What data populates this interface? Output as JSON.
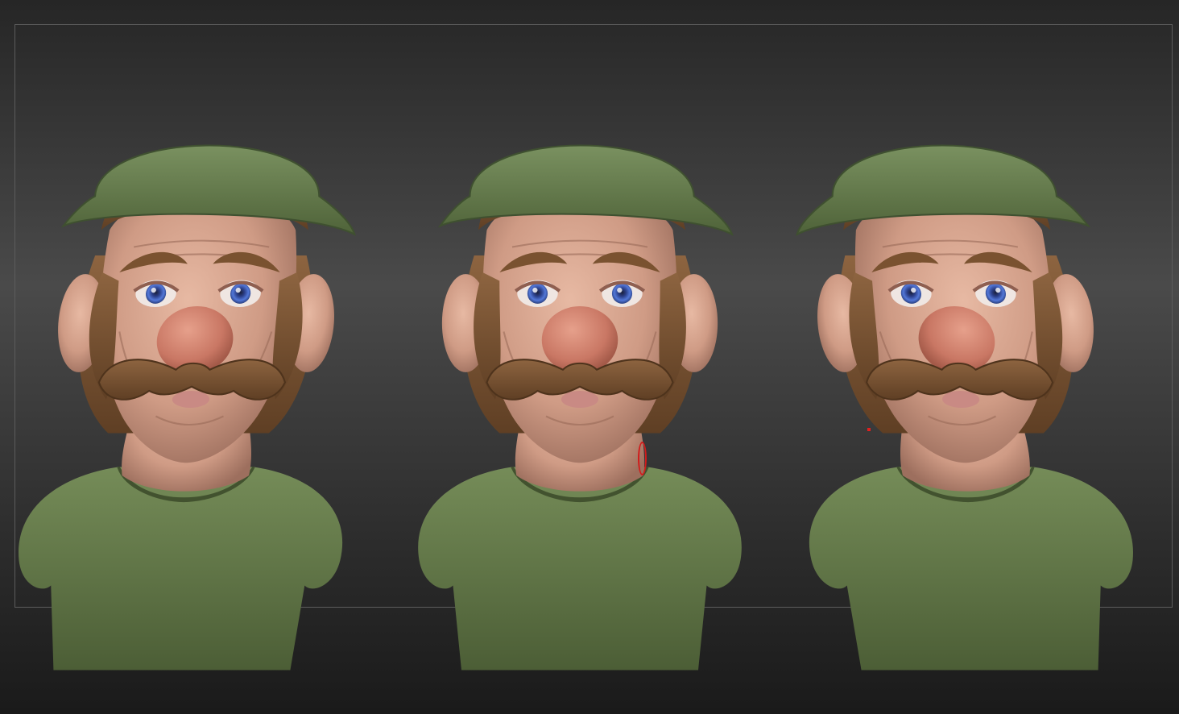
{
  "viewport": {
    "description_colors": {
      "background_top": "#262626",
      "background_mid": "#4a4a4a",
      "background_bottom": "#1a1a1a",
      "skin": "#d7a58f",
      "nose": "#d07a66",
      "hair": "#7b5634",
      "cap": "#667d4c",
      "shirt": "#657b4a",
      "eye_iris": "#3f63c4",
      "brush_cursor": "#d21b1b"
    },
    "views": [
      {
        "name": "three-quarter-left"
      },
      {
        "name": "front"
      },
      {
        "name": "three-quarter-right"
      }
    ]
  }
}
